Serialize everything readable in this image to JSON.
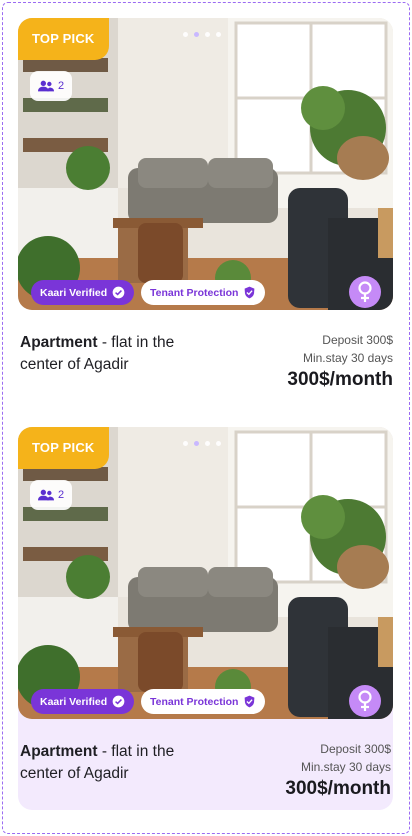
{
  "listings": [
    {
      "badge": "TOP PICK",
      "guests": "2",
      "verified_label": "Kaari Verified",
      "protection_label": "Tenant Protection",
      "title_bold": "Apartment",
      "title_rest": " - flat in the center of Agadir",
      "deposit": "Deposit 300$",
      "min_stay": "Min.stay 30 days",
      "price": "300$/month",
      "carousel_index": 2,
      "carousel_count": 4
    },
    {
      "badge": "TOP PICK",
      "guests": "2",
      "verified_label": "Kaari Verified",
      "protection_label": "Tenant Protection",
      "title_bold": "Apartment",
      "title_rest": " - flat in the center of Agadir",
      "deposit": "Deposit 300$",
      "min_stay": "Min.stay 30 days",
      "price": "300$/month",
      "carousel_index": 2,
      "carousel_count": 4
    }
  ],
  "icons": {
    "favorite": "heart-icon",
    "guests": "people-icon",
    "verified": "check-badge-icon",
    "gender": "female-icon"
  },
  "colors": {
    "top_pick": "#f5b31a",
    "brand_purple": "#7a35d8",
    "gender_badge": "#c58af7",
    "selected_card_bg": "#f3eafd"
  }
}
